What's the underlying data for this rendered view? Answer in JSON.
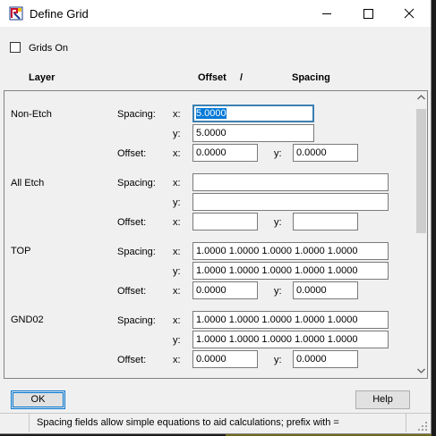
{
  "window": {
    "title": "Define Grid"
  },
  "grids_on": {
    "label": "Grids On",
    "checked": false
  },
  "headers": {
    "layer": "Layer",
    "offset": "Offset",
    "slash": "/",
    "spacing": "Spacing"
  },
  "labels": {
    "spacing": "Spacing:",
    "offset": "Offset:",
    "x": "x:",
    "y": "y:"
  },
  "layers": [
    {
      "name": "Non-Etch",
      "spacing_x": "5.0000",
      "spacing_y": "5.0000",
      "offset_x": "0.0000",
      "offset_y": "0.0000"
    },
    {
      "name": "All Etch",
      "spacing_x": "",
      "spacing_y": "",
      "offset_x": "",
      "offset_y": ""
    },
    {
      "name": "TOP",
      "spacing_x": "1.0000 1.0000 1.0000 1.0000 1.0000",
      "spacing_y": "1.0000 1.0000 1.0000 1.0000 1.0000",
      "offset_x": "0.0000",
      "offset_y": "0.0000"
    },
    {
      "name": "GND02",
      "spacing_x": "1.0000 1.0000 1.0000 1.0000 1.0000",
      "spacing_y": "1.0000 1.0000 1.0000 1.0000 1.0000",
      "offset_x": "0.0000",
      "offset_y": "0.0000"
    }
  ],
  "buttons": {
    "ok": "OK",
    "help": "Help"
  },
  "status": "Spacing fields allow simple equations to aid calculations; prefix with ="
}
